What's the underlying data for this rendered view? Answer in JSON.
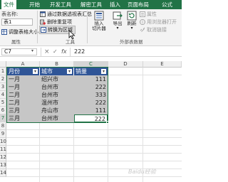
{
  "ribbon": {
    "tabs": [
      {
        "label": "文件",
        "active": true
      },
      {
        "label": "开始",
        "active": false
      },
      {
        "label": "开发工具",
        "active": false
      },
      {
        "label": "解密工具",
        "active": false
      },
      {
        "label": "插入",
        "active": false
      },
      {
        "label": "页面布局",
        "active": false
      },
      {
        "label": "公式",
        "active": false
      }
    ],
    "table_name_label": "表名称:",
    "table_name_value": "表1",
    "resize_table": "调整表格大小",
    "properties_group": "属性",
    "pivot_summary": "通过数据透视表汇总",
    "remove_duplicates": "删除重复项",
    "convert_to_range": "转换为区域",
    "tools_group": "工具",
    "insert_slicer": "插入\n切片器",
    "export": "导出",
    "refresh": "刷新",
    "external_props": "属性",
    "open_in_browser": "用浏览器打开",
    "unlink": "取消链接",
    "external_group": "外部表数据"
  },
  "formula_bar": {
    "name_box": "C7",
    "cancel": "×",
    "enter": "✓",
    "fx": "fx",
    "value": "222"
  },
  "grid": {
    "columns": [
      "A",
      "B",
      "C",
      "D",
      "E"
    ],
    "rows": [
      "1",
      "2",
      "3",
      "4",
      "5",
      "6",
      "7",
      "8",
      "9",
      "10",
      "11",
      "12",
      "13",
      "14"
    ],
    "headers": [
      "月份",
      "城市",
      "销量"
    ],
    "data": [
      [
        "一月",
        "绍兴市",
        "111"
      ],
      [
        "一月",
        "台州市",
        "222"
      ],
      [
        "二月",
        "台州市",
        "333"
      ],
      [
        "二月",
        "温州市",
        "222"
      ],
      [
        "三月",
        "舟山市",
        "111"
      ],
      [
        "三月",
        "台州市",
        "222"
      ]
    ]
  },
  "colors": {
    "accent": "#217346",
    "header_fill": "#2f5597",
    "selection_fill": "#c6c6c6",
    "band_fill": "#dde4f0"
  },
  "watermark": "Baidu经验"
}
